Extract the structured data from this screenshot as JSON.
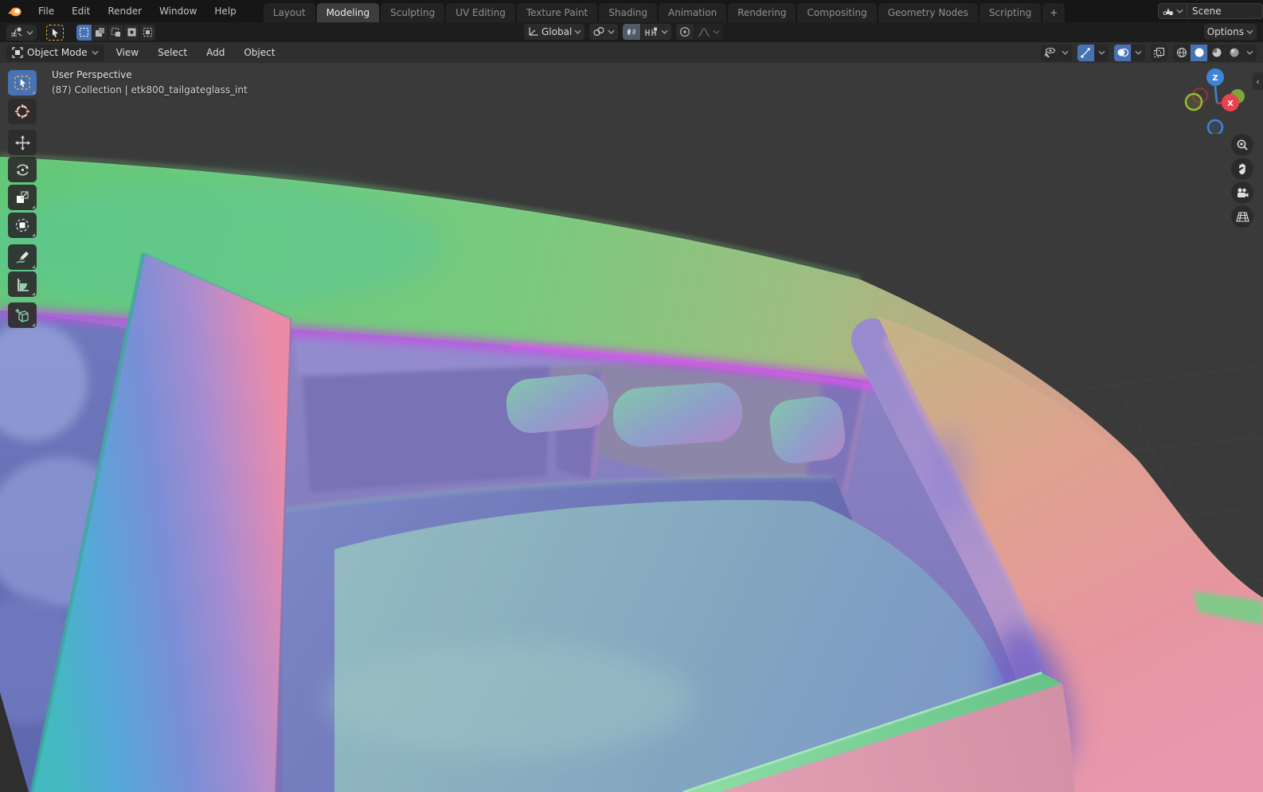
{
  "topbar": {
    "menus": [
      "File",
      "Edit",
      "Render",
      "Window",
      "Help"
    ],
    "tabs": [
      "Layout",
      "Modeling",
      "Sculpting",
      "UV Editing",
      "Texture Paint",
      "Shading",
      "Animation",
      "Rendering",
      "Compositing",
      "Geometry Nodes",
      "Scripting"
    ],
    "active_tab": "Modeling",
    "new_tab_button": "+",
    "scene_selector": {
      "label": "Scene"
    }
  },
  "tool_header": {
    "transform_orientation": "Global",
    "options_button": "Options",
    "select_modes": [
      "set",
      "extend",
      "subtract",
      "invert",
      "intersect"
    ],
    "active_select_mode": "set"
  },
  "viewport_header": {
    "mode_selector": "Object Mode",
    "menus": [
      "View",
      "Select",
      "Add",
      "Object"
    ],
    "shading_modes": [
      "wireframe",
      "solid",
      "material-preview",
      "rendered"
    ],
    "active_shading_mode": "solid"
  },
  "viewport": {
    "overlay": {
      "view_label": "User Perspective",
      "collection_label": "(87) Collection | etk800_tailgateglass_int"
    },
    "toolbar_tools": [
      "select-box",
      "cursor",
      "move",
      "rotate",
      "scale",
      "transform",
      "annotate",
      "measure",
      "add-cube"
    ],
    "active_tool": "select-box",
    "nav_gizmo": {
      "axis_z": "Z",
      "axis_x": "X"
    },
    "side_buttons": [
      "zoom",
      "pan",
      "camera-view",
      "toggle-orthographic"
    ],
    "sidebar_toggle": "‹"
  },
  "colors": {
    "accent_blue": "#4772b3",
    "topbar_bg": "#161616",
    "header_bg": "#1d1d1d",
    "viewport_header_bg": "#2f2f2f",
    "viewport_bg": "#3a3a3a",
    "axis_x_red": "#e8434f",
    "axis_z_blue": "#3f84d8",
    "axis_y_green": "#9ab832",
    "matcap_green": "#6fca7c",
    "matcap_magenta": "#c44fe0",
    "matcap_cyan": "#4ec9c4",
    "matcap_pink": "#e88daa",
    "matcap_blue": "#6b74bb",
    "matcap_salmon": "#e59a97"
  }
}
